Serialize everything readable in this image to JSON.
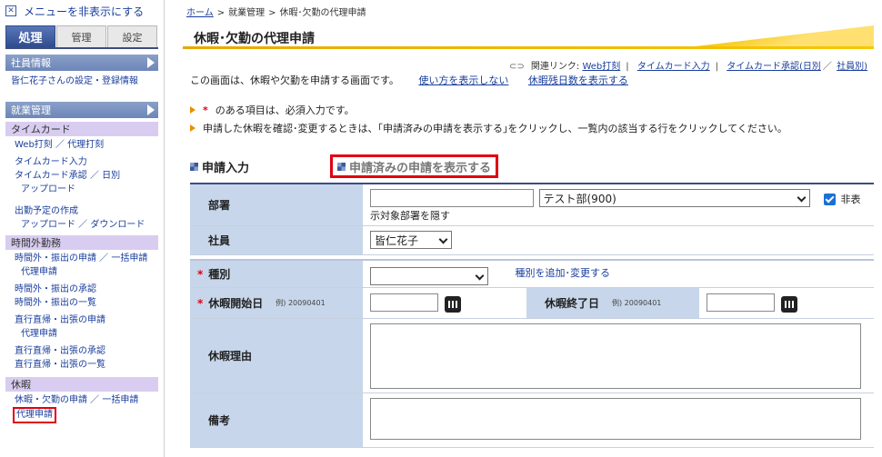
{
  "sidebar": {
    "hide_menu_label": "メニューを非表示にする",
    "tabs": [
      {
        "label": "処理",
        "active": true
      },
      {
        "label": "管理",
        "active": false
      },
      {
        "label": "設定",
        "active": false
      }
    ],
    "employee_info": {
      "header": "社員情報",
      "link": "皆仁花子さんの設定・登録情報"
    },
    "work_mgmt": {
      "header": "就業管理",
      "timecard": {
        "header": "タイムカード",
        "links": [
          "Web打刻 ／ 代理打刻",
          "タイムカード入力",
          "タイムカード承認 ／ 日別",
          "アップロード",
          "出勤予定の作成",
          "アップロード ／ ダウンロード"
        ]
      },
      "overtime": {
        "header": "時間外勤務",
        "links": [
          "時間外・振出の申請 ／ 一括申請",
          "代理申請",
          "時間外・振出の承認",
          "時間外・振出の一覧",
          "直行直帰・出張の申請",
          "代理申請",
          "直行直帰・出張の承認",
          "直行直帰・出張の一覧"
        ]
      },
      "leave": {
        "header": "休暇",
        "links": [
          "休暇・欠勤の申請 ／ 一括申請",
          "代理申請"
        ]
      }
    }
  },
  "main": {
    "breadcrumb": [
      "ホーム",
      "就業管理",
      "休暇･欠勤の代理申請"
    ],
    "title": "休暇･欠勤の代理申請",
    "related": {
      "label": "関連リンク:",
      "links": [
        "Web打刻",
        "タイムカード入力",
        "タイムカード承認(日別",
        "社員別)"
      ]
    },
    "description": "この画面は、休暇や欠勤を申請する画面です。",
    "help_link": "使い方を表示しない",
    "remaining_link": "休暇残日数を表示する",
    "note1": "のある項目は、必須入力です。",
    "note1_mark": "*",
    "note2": "申請した休暇を確認･変更するときは、｢申請済みの申請を表示する｣をクリックし、一覧内の該当する行をクリックしてください。",
    "section_tabs": {
      "input": "申請入力",
      "show_submitted": "申請済みの申請を表示する"
    },
    "form": {
      "dept_label": "部署",
      "dept_text": "",
      "dept_select": "テスト部(900)",
      "hide_checkbox_label": "非表",
      "hide_dept_note": "示対象部署を隠す",
      "employee_label": "社員",
      "employee_select": "皆仁花子",
      "type_label": "種別",
      "type_select": "",
      "type_add_link": "種別を追加･変更する",
      "start_label": "休暇開始日",
      "start_example": "例) 20090401",
      "start_value": "",
      "end_label": "休暇終了日",
      "end_example": "例) 20090401",
      "end_value": "",
      "reason_label": "休暇理由",
      "reason_value": "",
      "remarks_label": "備考",
      "remarks_value": "",
      "required_mark": "*"
    }
  },
  "colors": {
    "accent_red": "#e00010",
    "nav_blue": "#3c4c82",
    "label_bg": "#c7d6ea",
    "sub_head_bg": "#d8cdf0",
    "title_yellow": "#f4c400"
  }
}
